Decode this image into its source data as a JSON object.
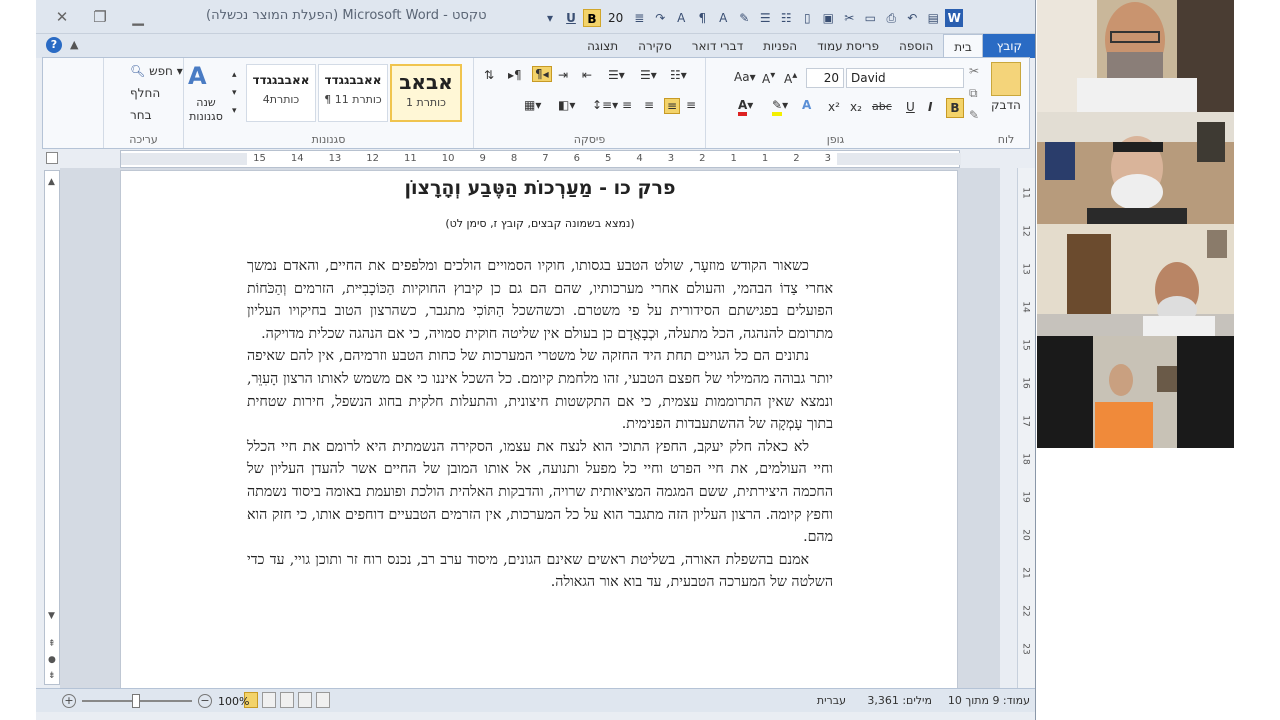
{
  "window": {
    "title": "טקסט - Microsoft Word (הפעלת המוצר נכשלה)"
  },
  "qat": {
    "font_size": "20",
    "bold": "B",
    "underline": "U"
  },
  "tabs": [
    {
      "label": "קובץ"
    },
    {
      "label": "בית"
    },
    {
      "label": "הוספה"
    },
    {
      "label": "פריסת עמוד"
    },
    {
      "label": "הפניות"
    },
    {
      "label": "דברי דואר"
    },
    {
      "label": "סקירה"
    },
    {
      "label": "תצוגה"
    }
  ],
  "ribbon": {
    "clipboard": {
      "label": "לוח",
      "paste": "הדבק"
    },
    "font": {
      "label": "גופן",
      "name": "David",
      "size": "20",
      "bold": "B",
      "italic": "I",
      "underline": "U",
      "strike": "abc",
      "sub": "x₂",
      "sup": "x²"
    },
    "paragraph": {
      "label": "פיסקה"
    },
    "styles": {
      "label": "סגנונות",
      "items": [
        {
          "sample": "אבאב",
          "name": "כותרת 1"
        },
        {
          "sample": "אאבבגגדד",
          "name": "¶ כותרת 11"
        },
        {
          "sample": "אאבבגגדד",
          "name": "כותרת4"
        }
      ],
      "change": "שנה סגנונות"
    },
    "editing": {
      "label": "עריכה",
      "find": "חפש",
      "replace": "החלף",
      "select": "בחר"
    }
  },
  "ruler": {
    "ticks": [
      "3",
      "2",
      "1",
      "1",
      "2",
      "3",
      "4",
      "5",
      "6",
      "7",
      "8",
      "9",
      "10",
      "11",
      "12",
      "13",
      "14",
      "15"
    ]
  },
  "vruler": {
    "ticks": [
      "11",
      "12",
      "13",
      "14",
      "15",
      "16",
      "17",
      "18",
      "19",
      "20",
      "21",
      "22",
      "23"
    ]
  },
  "document": {
    "title": "פרק כו - מַעַרְכוֹת הַטֶּבַע וְהָרָצוֹן",
    "subtitle": "(נמצא בשמונה קבצים, קובץ ז, סימן לט)",
    "paragraphs": [
      "כשאור הקודש מוזעָר, שולט הטבע בגסותו, חוקיו הסמויים הולכים ומלפפים את החיים, והאדם נמשך אחרי צַדוֹ הבהמי, והעולם אחרי מערכותיו, שהם הם גם כן קיבוץ החוקיות הַכּוֹכָבִיּית, הזרמים וְהַכֹּחוֹת הפועלים בפגישתם הסידורית על פי משטרם. וכשהשכל הַתּוֹכִי מתגבר, כשהרצון הטוב בחיקויו העליון מתרומם להנהגה, הכל מתעלה, וּכְבָאֲדָם כן בעולם אין שליטה חוקית סמויה, כי אם הנהגה שכלית מדויקה.",
      "נתונים הם כל הגויים תחת היד החזקה של משטרי המערכות של כחות הטבע וזרמיהם, אין להם שאיפה יותר גבוהה מהמילוי של חפצם הטבעי, זהו מלחמת קיומם. כל השכל איננו כי אם משמש לאותו הרצון הָעִוֵּר, ונמצא שאין התרוממות עצמית, כי אם התקשטות חיצונית, והתעלות חלקית בחוג הנשפל, חירות שטחית בתוך עָמְקָה של ההשתעבדות הפנימית.",
      "לא כאלה חלק יעקב, החפץ התוכי הוא לנצח את עצמו, הסקירה הנשמתית היא לרומם את חיי הכלל וחיי העולמים, את חיי הפרט וחיי כל מפעל ותנועה, אל אותו המובן של החיים אשר להעדן העליון של החכמה היצירתית, ששם המגמה המציאותית שרויה, והדבקות האלהית הולכת ופועמת באומה ביסוד נשמתה וחפץ קיומה. הרצון העליון הזה מתגבר הוא על כל המערכות, אין הזרמים הטבעיים דוחפים אותו, כי חזק הוא מהם.",
      "אמנם בהשפלת האורה, בשליטת ראשים שאינם הגונים, מיסוד ערב רב, נכנס רוח זר ותוכן גויי, עד כדי השלטה של המערכה הטבעית, עד בוא אור הגאולה."
    ]
  },
  "status": {
    "page": "עמוד: 9 מתוך 10",
    "words": "מילים: 3,361",
    "lang": "עברית",
    "zoom": "100%"
  }
}
